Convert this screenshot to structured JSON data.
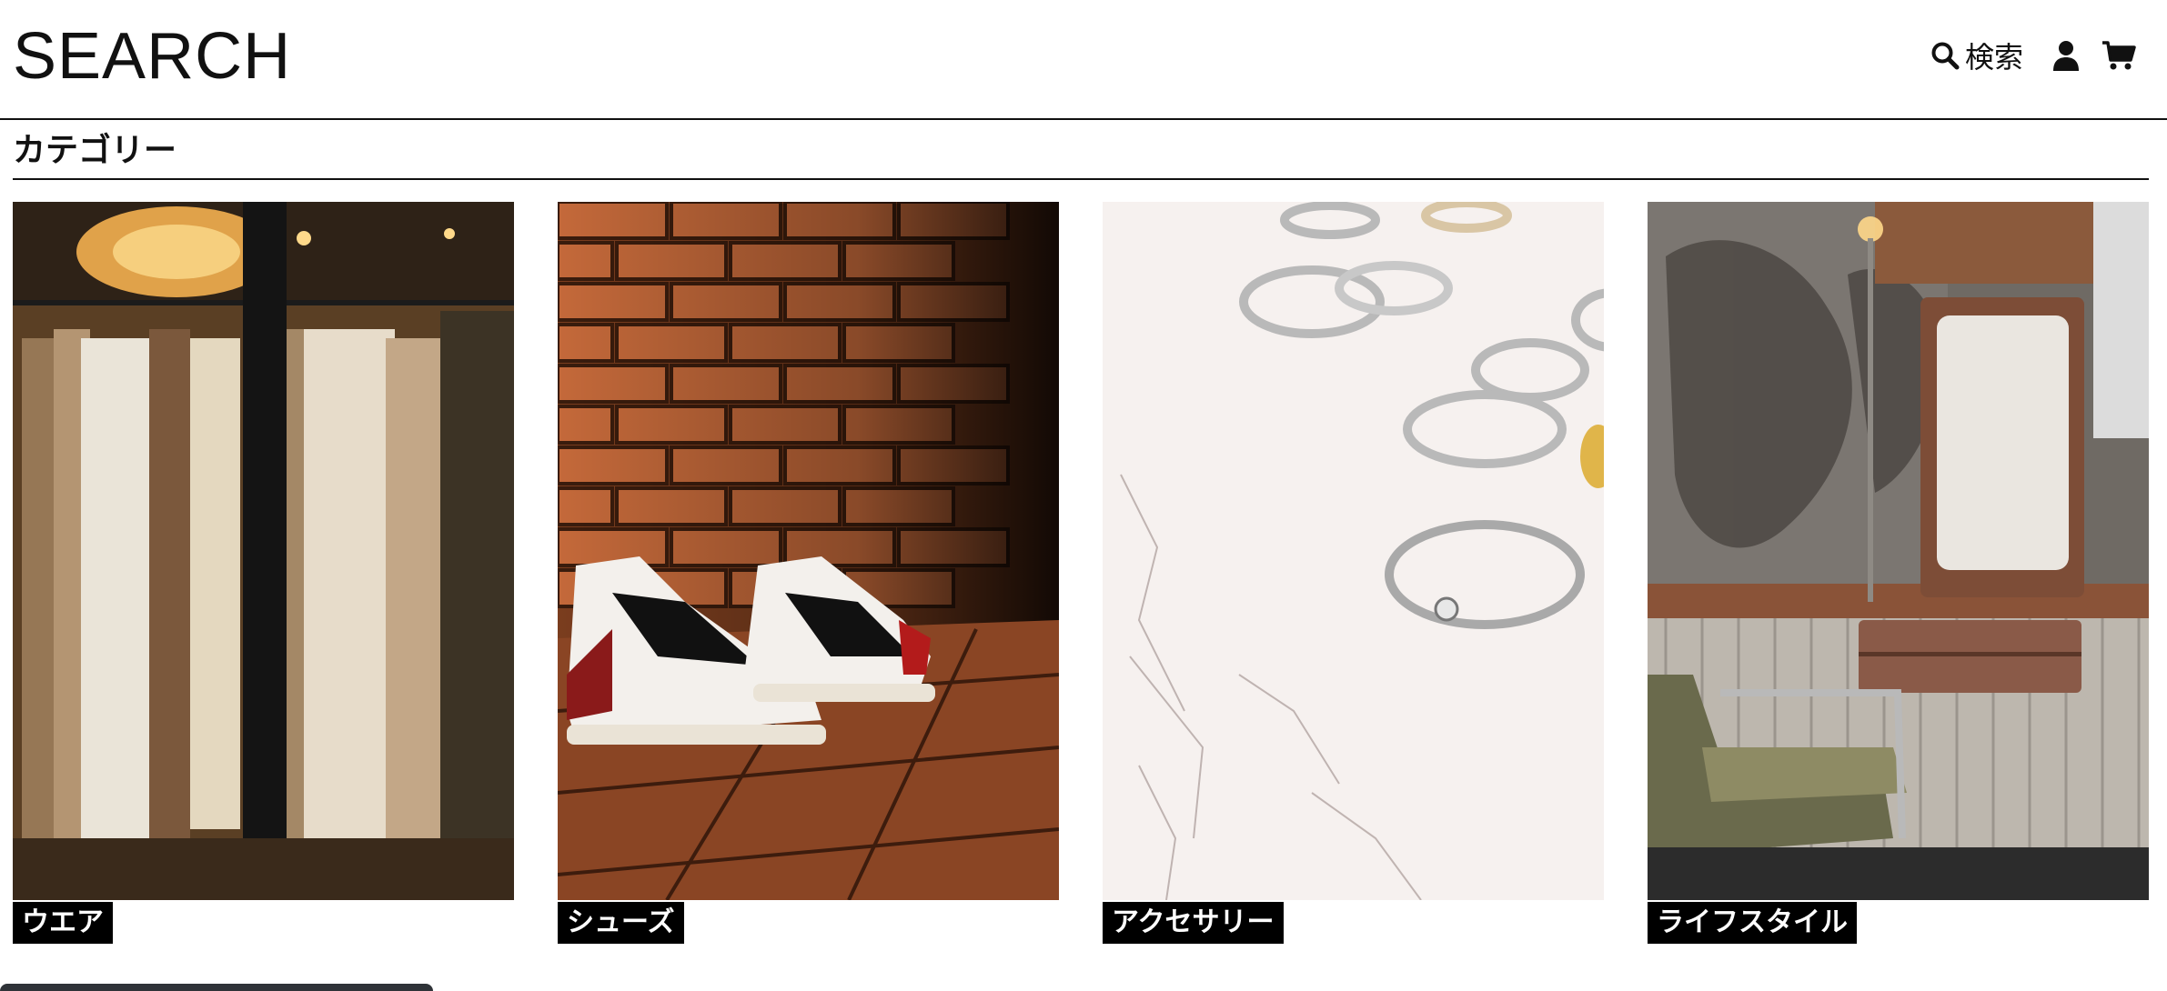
{
  "header": {
    "logo": "SEARCH",
    "nav": {
      "search_label": "検索",
      "search_icon": "magnifier-icon",
      "user_icon": "user-icon",
      "cart_icon": "cart-icon"
    }
  },
  "section": {
    "title": "カテゴリー"
  },
  "categories": [
    {
      "label": "ウエア",
      "image": "clothing-rack-photo"
    },
    {
      "label": "シューズ",
      "image": "sneakers-brick-wall-photo"
    },
    {
      "label": "アクセサリー",
      "image": "silver-rings-photo"
    },
    {
      "label": "ライフスタイル",
      "image": "vintage-interior-photo"
    }
  ],
  "colors": {
    "text": "#111111",
    "label_background": "#000000",
    "label_text": "#ffffff",
    "background": "#ffffff"
  }
}
